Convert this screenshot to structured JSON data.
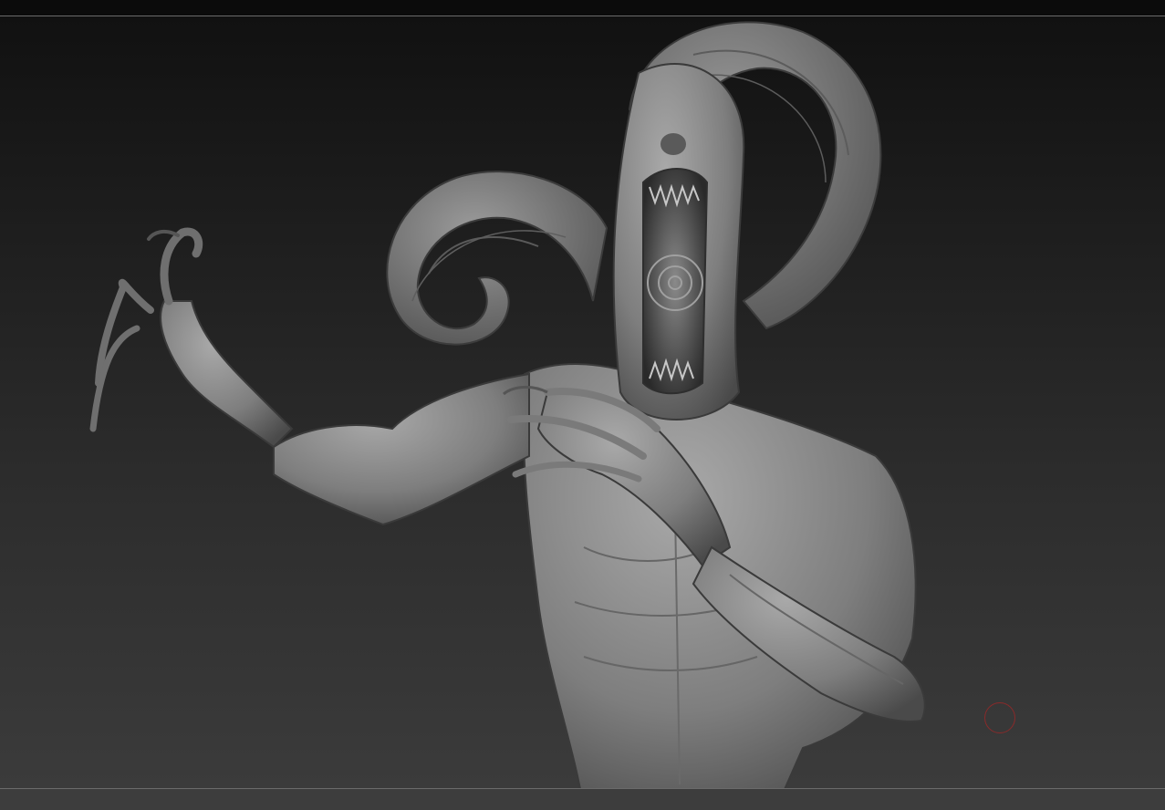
{
  "app": {
    "name": "",
    "title": ""
  },
  "viewport": {
    "background_top": "#101010",
    "background_bottom": "#3b3b3b",
    "frame_line_color": "#6a6a6a"
  },
  "model": {
    "icon": "creature-sculpt-icon",
    "material_color": "#8e8e8e"
  },
  "cursor": {
    "icon": "brush-cursor-icon",
    "color": "#8a2a2a"
  }
}
